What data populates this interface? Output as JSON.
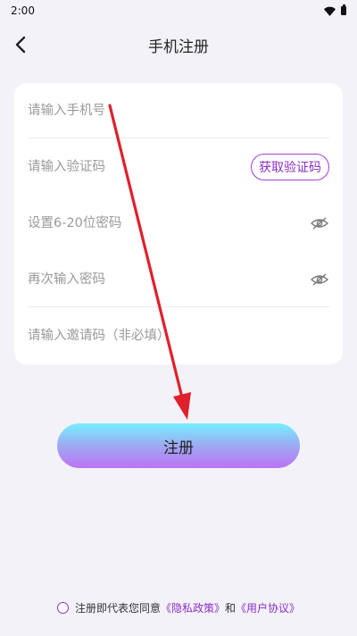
{
  "status_bar": {
    "time": "2:00"
  },
  "header": {
    "title": "手机注册"
  },
  "form": {
    "phone": {
      "placeholder": "请输入手机号",
      "value": ""
    },
    "code": {
      "placeholder": "请输入验证码",
      "value": "",
      "get_code_label": "获取验证码"
    },
    "password": {
      "placeholder": "设置6-20位密码",
      "value": ""
    },
    "confirm_password": {
      "placeholder": "再次输入密码",
      "value": ""
    },
    "invite_code": {
      "placeholder": "请输入邀请码（非必填）",
      "value": ""
    }
  },
  "register_label": "注册",
  "agreement": {
    "prefix": "注册即代表您同意",
    "privacy_link": "《隐私政策》",
    "conjunction": "和",
    "terms_link": "《用户协议》"
  },
  "colors": {
    "accent": "#8c2fc6",
    "arrow": "#e0202a",
    "background": "#f4f2f9"
  },
  "icons": {
    "back": "chevron-left-icon",
    "password_toggle": "eye-off-icon"
  }
}
